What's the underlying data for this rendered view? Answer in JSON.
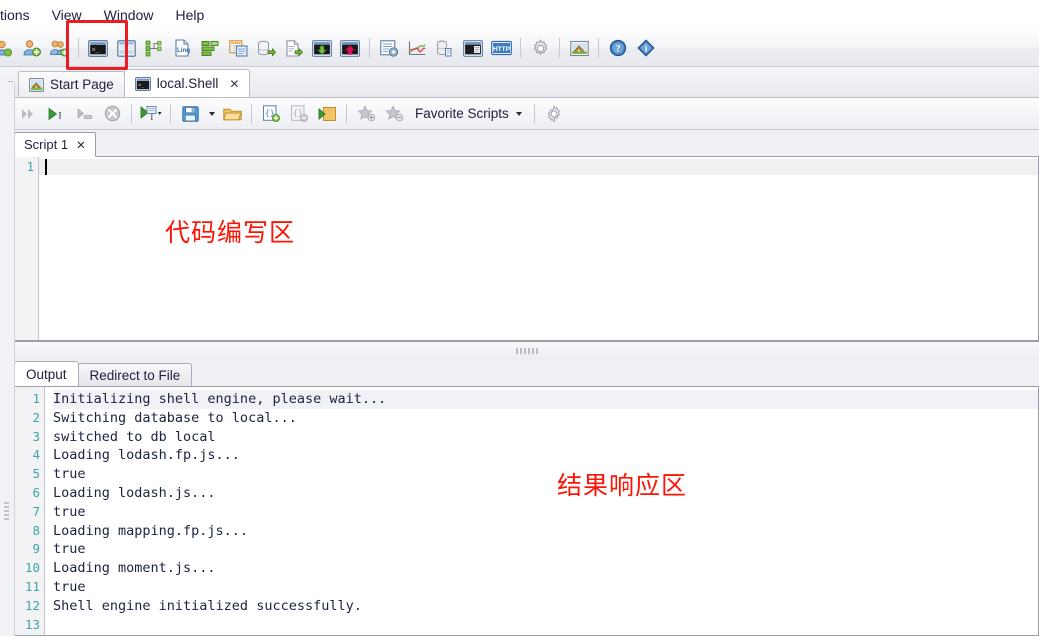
{
  "app": {
    "title": "local.Shell"
  },
  "menubar": {
    "items": [
      {
        "label": "tions"
      },
      {
        "label": "View"
      },
      {
        "label": "Window"
      },
      {
        "label": "Help"
      }
    ]
  },
  "main_toolbar": {
    "buttons": [
      {
        "name": "user-icon",
        "label": "User"
      },
      {
        "name": "user-add-icon",
        "label": "Add User"
      },
      {
        "name": "user-group-add-icon",
        "label": "Add User Group"
      },
      {
        "name": "shell-console-icon",
        "label": "Open Shell"
      },
      {
        "name": "window-panel-icon",
        "label": "Window Panel"
      },
      {
        "name": "tree-node-icon",
        "label": "Tree Node"
      },
      {
        "name": "linq-query-icon",
        "label": "Linq Query"
      },
      {
        "name": "green-grid-icon",
        "label": "Data Grid"
      },
      {
        "name": "table-copy-icon",
        "label": "Table Copy"
      },
      {
        "name": "db-export-icon",
        "label": "Database Export"
      },
      {
        "name": "doc-export-icon",
        "label": "Document Export"
      },
      {
        "name": "shell-import-icon",
        "label": "Shell Import"
      },
      {
        "name": "shell-upload-icon",
        "label": "Shell Upload"
      },
      {
        "name": "list-settings-icon",
        "label": "List Settings"
      },
      {
        "name": "chart-icon",
        "label": "Chart"
      },
      {
        "name": "server-doc-icon",
        "label": "Server Document"
      },
      {
        "name": "shell-window-icon",
        "label": "Shell Window"
      },
      {
        "name": "http-icon",
        "label": "HTTP"
      },
      {
        "name": "gear-icon",
        "label": "Options"
      },
      {
        "name": "home-icon",
        "label": "Home"
      },
      {
        "name": "help-icon",
        "label": "Help"
      },
      {
        "name": "info-icon",
        "label": "About"
      }
    ],
    "annotation_box": {
      "color": "#ec1c24",
      "target": "shell-console-icon"
    }
  },
  "document_tabs": {
    "collapse_glyph": "«",
    "tabs": [
      {
        "label": "Start Page",
        "icon": "home-page-icon",
        "active": false,
        "closable": false
      },
      {
        "label": "local.Shell",
        "icon": "shell-console-icon",
        "active": true,
        "closable": true,
        "close_glyph": "✕"
      }
    ]
  },
  "script_toolbar": {
    "buttons": [
      {
        "name": "run-all-icon",
        "label": "Run All"
      },
      {
        "name": "run-statement-icon",
        "label": "Run Current Statement"
      },
      {
        "name": "step-icon",
        "label": "Step"
      },
      {
        "name": "stop-icon",
        "label": "Stop"
      },
      {
        "name": "run-to-cursor-icon",
        "label": "Run To Cursor"
      },
      {
        "name": "save-icon",
        "label": "Save"
      },
      {
        "name": "open-folder-icon",
        "label": "Open"
      },
      {
        "name": "add-snippet-icon",
        "label": "Add Snippet"
      },
      {
        "name": "remove-snippet-icon",
        "label": "Remove Snippet"
      },
      {
        "name": "open-script-icon",
        "label": "Open Script"
      },
      {
        "name": "add-favorite-icon",
        "label": "Add To Favorites"
      },
      {
        "name": "remove-favorite-icon",
        "label": "Remove From Favorites"
      },
      {
        "name": "favorite-scripts-menu",
        "label": "Favorite Scripts"
      },
      {
        "name": "script-settings-icon",
        "label": "Script Settings"
      }
    ],
    "favorite_scripts_label": "Favorite Scripts"
  },
  "editor": {
    "tab": {
      "label": "Script 1",
      "close_glyph": "✕"
    },
    "line_numbers": [
      "1"
    ],
    "content": "",
    "annotation": "代码编写区",
    "annotation_color": "#fc1405"
  },
  "output": {
    "tabs": [
      {
        "label": "Output",
        "active": true
      },
      {
        "label": "Redirect to File",
        "active": false
      }
    ],
    "annotation": "结果响应区",
    "annotation_color": "#fc1405",
    "line_numbers": [
      "1",
      "2",
      "3",
      "4",
      "5",
      "6",
      "7",
      "8",
      "9",
      "10",
      "11",
      "12",
      "13"
    ],
    "lines": [
      "Initializing shell engine, please wait...",
      "Switching database to local...",
      "switched to db local",
      "Loading lodash.fp.js...",
      "true",
      "Loading lodash.js...",
      "true",
      "Loading mapping.fp.js...",
      "true",
      "Loading moment.js...",
      "true",
      "Shell engine initialized successfully.",
      ""
    ]
  }
}
